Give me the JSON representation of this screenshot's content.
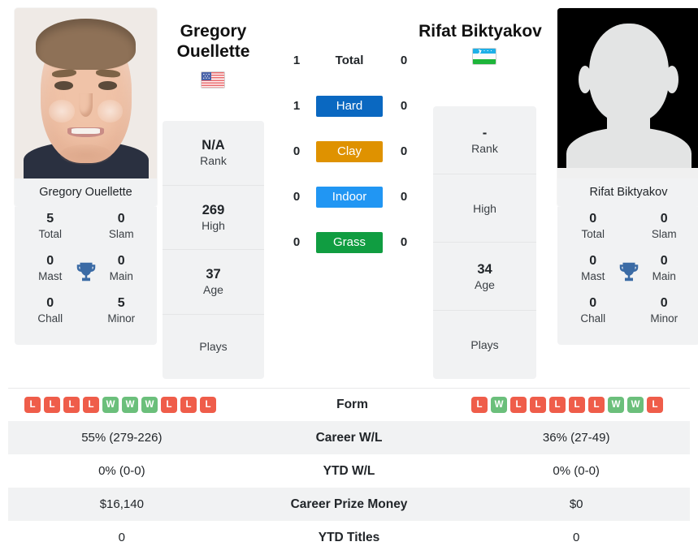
{
  "players": {
    "left": {
      "name": "Gregory Ouellette",
      "name_line1": "Gregory",
      "name_line2": "Ouellette",
      "caption": "Gregory Ouellette",
      "flag": "us-flag-icon",
      "flag_alt": "United States",
      "info": [
        {
          "value": "N/A",
          "label": "Rank"
        },
        {
          "value": "269",
          "label": "High"
        },
        {
          "value": "37",
          "label": "Age"
        },
        {
          "value": "",
          "label": "Plays"
        }
      ],
      "titles": [
        {
          "value": "5",
          "label": "Total"
        },
        {
          "value": "0",
          "label": "Slam"
        },
        {
          "value": "0",
          "label": "Mast"
        },
        {
          "value": "0",
          "label": "Main"
        },
        {
          "value": "0",
          "label": "Chall"
        },
        {
          "value": "5",
          "label": "Minor"
        }
      ],
      "form": [
        "L",
        "L",
        "L",
        "L",
        "W",
        "W",
        "W",
        "L",
        "L",
        "L"
      ],
      "career_wl": "55% (279-226)",
      "ytd_wl": "0% (0-0)",
      "career_prize_money": "$16,140",
      "ytd_titles": "0"
    },
    "right": {
      "name": "Rifat Biktyakov",
      "name_line1": "Rifat Biktyakov",
      "name_line2": "",
      "caption": "Rifat Biktyakov",
      "flag": "uz-flag-icon",
      "flag_alt": "Uzbekistan",
      "info": [
        {
          "value": "-",
          "label": "Rank"
        },
        {
          "value": "",
          "label": "High"
        },
        {
          "value": "34",
          "label": "Age"
        },
        {
          "value": "",
          "label": "Plays"
        }
      ],
      "titles": [
        {
          "value": "0",
          "label": "Total"
        },
        {
          "value": "0",
          "label": "Slam"
        },
        {
          "value": "0",
          "label": "Mast"
        },
        {
          "value": "0",
          "label": "Main"
        },
        {
          "value": "0",
          "label": "Chall"
        },
        {
          "value": "0",
          "label": "Minor"
        }
      ],
      "form": [
        "L",
        "W",
        "L",
        "L",
        "L",
        "L",
        "L",
        "W",
        "W",
        "L"
      ],
      "career_wl": "36% (27-49)",
      "ytd_wl": "0% (0-0)",
      "career_prize_money": "$0",
      "ytd_titles": "0"
    }
  },
  "surfaces": [
    {
      "label": "Total",
      "left": "1",
      "right": "0",
      "style": "plain",
      "color": ""
    },
    {
      "label": "Hard",
      "left": "1",
      "right": "0",
      "style": "badge",
      "color": "#0a68c1"
    },
    {
      "label": "Clay",
      "left": "0",
      "right": "0",
      "style": "badge",
      "color": "#df9200"
    },
    {
      "label": "Indoor",
      "left": "0",
      "right": "0",
      "style": "badge",
      "color": "#2196f3"
    },
    {
      "label": "Grass",
      "left": "0",
      "right": "0",
      "style": "badge",
      "color": "#109d41"
    }
  ],
  "table_rows": [
    {
      "label": "Form",
      "type": "form"
    },
    {
      "label": "Career W/L",
      "type": "text",
      "left": "55% (279-226)",
      "right": "36% (27-49)"
    },
    {
      "label": "YTD W/L",
      "type": "text",
      "left": "0% (0-0)",
      "right": "0% (0-0)"
    },
    {
      "label": "Career Prize Money",
      "type": "text",
      "left": "$16,140",
      "right": "$0"
    },
    {
      "label": "YTD Titles",
      "type": "text",
      "left": "0",
      "right": "0"
    }
  ],
  "colors": {
    "win": "#6bbf7b",
    "loss": "#ef5d4a",
    "trophy": "#3b6ba5",
    "card_bg": "#f1f2f3"
  }
}
